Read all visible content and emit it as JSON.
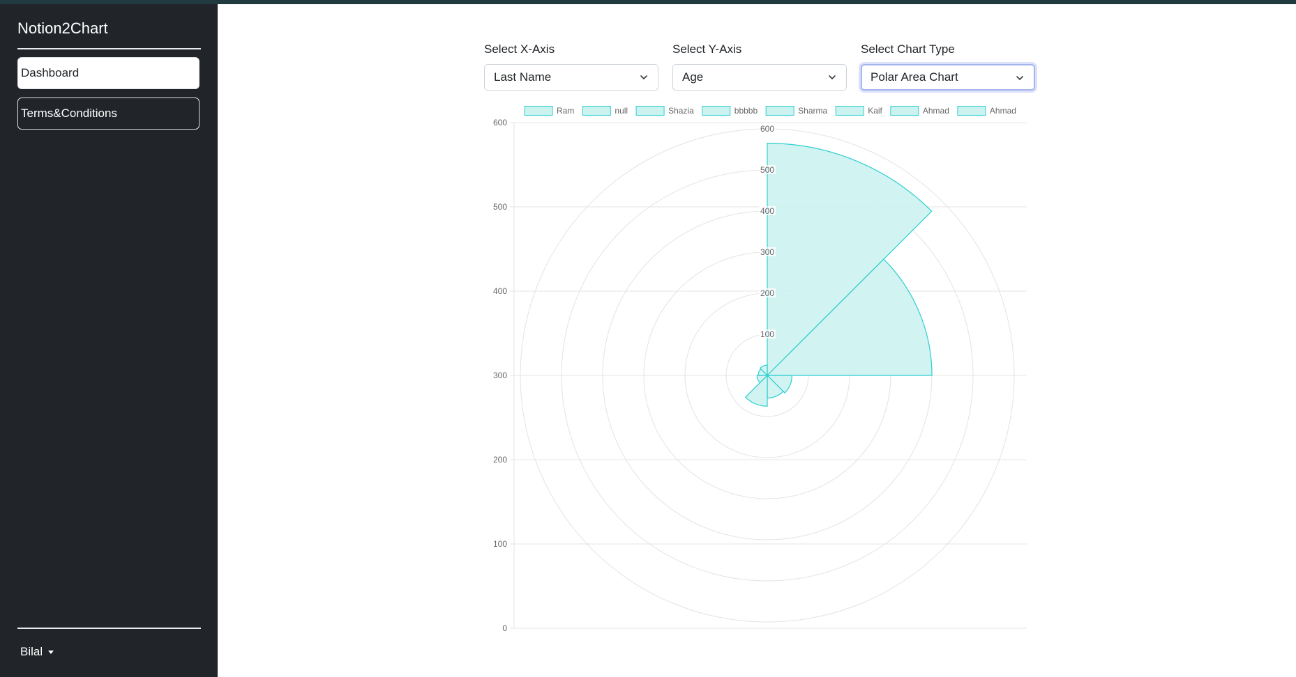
{
  "app": {
    "brand": "Notion2Chart"
  },
  "sidebar": {
    "items": [
      {
        "label": "Dashboard",
        "active": true
      },
      {
        "label": "Terms&Conditions",
        "active": false
      }
    ],
    "user": "Bilal"
  },
  "controls": {
    "x_axis": {
      "label": "Select X-Axis",
      "value": "Last Name"
    },
    "y_axis": {
      "label": "Select Y-Axis",
      "value": "Age"
    },
    "chart_type": {
      "label": "Select Chart Type",
      "value": "Polar Area Chart"
    }
  },
  "colors": {
    "fill": "#ccf2f0",
    "stroke": "#2ccfcf",
    "sidebar": "#212529"
  },
  "chart_data": {
    "type": "polar-area",
    "categories": [
      "Ram",
      "null",
      "Shazia",
      "bbbbb",
      "Sharma",
      "Kaif",
      "Ahmad",
      "Ahmad"
    ],
    "values": [
      565,
      400,
      60,
      55,
      75,
      25,
      22,
      25
    ],
    "radial_ticks": [
      "100",
      "200",
      "300",
      "400",
      "500",
      "600"
    ],
    "radial_range": [
      0,
      600
    ],
    "cartesian_y_ticks": [
      "0",
      "100",
      "200",
      "300",
      "400",
      "500",
      "600"
    ],
    "legend_position": "top",
    "grid": true
  }
}
